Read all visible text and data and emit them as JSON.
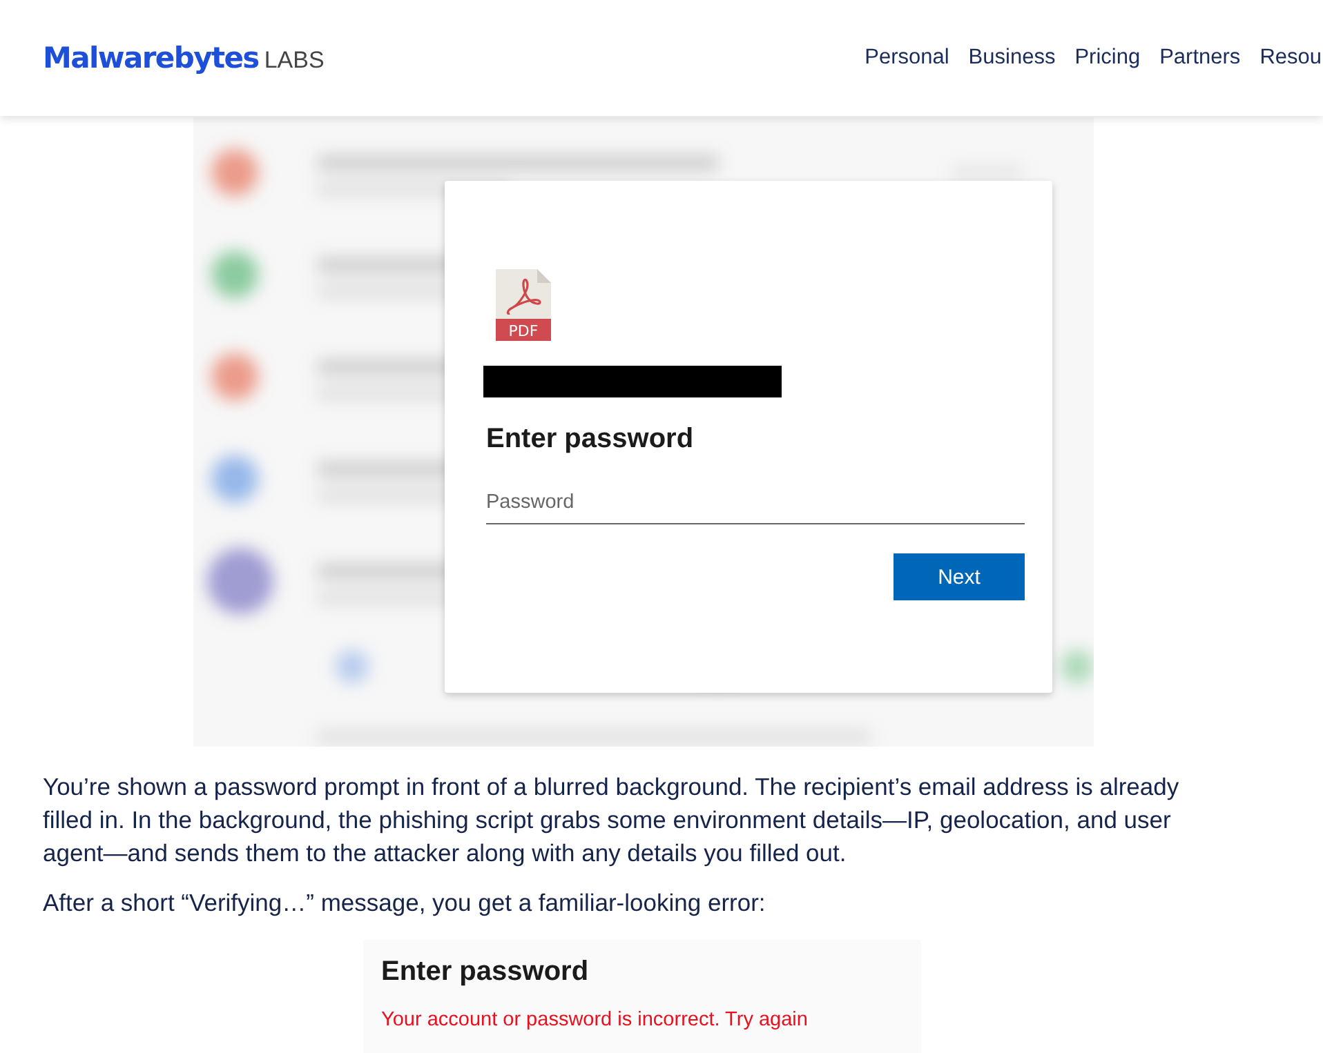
{
  "header": {
    "logo": {
      "brand": "Malwarebytes",
      "suffix": "LABS"
    },
    "nav": [
      "Personal",
      "Business",
      "Pricing",
      "Partners",
      "Resou"
    ]
  },
  "figure_1": {
    "dialog": {
      "file_badge": "PDF",
      "title": "Enter password",
      "password_field": {
        "placeholder": "Password"
      },
      "button": "Next"
    }
  },
  "paragraphs": [
    "You’re shown a password prompt in front of a blurred background. The recipient’s email address is already filled in. In the background, the phishing script grabs some environment details—IP, geolocation, and user agent—and sends them to the attacker along with any details you filled out.",
    "After a short “Verifying…” message, you get a familiar-looking error:"
  ],
  "figure_2": {
    "title": "Enter password",
    "error": "Your account or password is incorrect. Try again"
  }
}
